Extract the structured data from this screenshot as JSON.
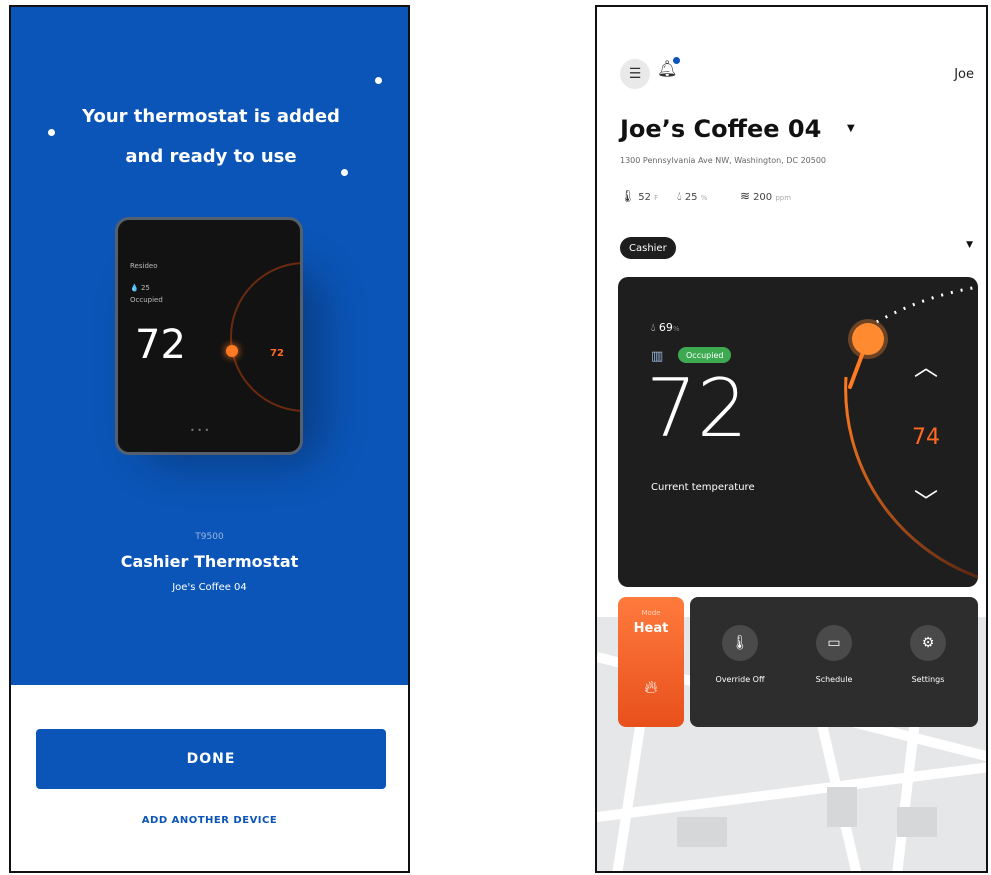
{
  "left_screen": {
    "headline_line1": "Your thermostat is added",
    "headline_line2": "and ready to use",
    "device_display": {
      "brand": "Resideo",
      "humidity": "25",
      "occupancy": "Occupied",
      "temperature": "72",
      "setpoint": "72"
    },
    "model": "T9500",
    "thermostat_name": "Cashier Thermostat",
    "location": "Joe's Coffee 04",
    "done_label": "DONE",
    "add_device_label": "ADD ANOTHER DEVICE",
    "colors": {
      "primary": "#0b55b8"
    }
  },
  "right_screen": {
    "user": "Joe",
    "store_name": "Joe’s Coffee 04",
    "address": "1300 Pennsylvania Ave NW, Washington, DC 20500",
    "metrics": [
      {
        "icon": "thermometer-icon",
        "value": "52",
        "unit": "F"
      },
      {
        "icon": "humidity-icon",
        "value": "25",
        "unit": "%"
      },
      {
        "icon": "air-quality-icon",
        "value": "200",
        "unit": "ppm"
      }
    ],
    "zone": "Cashier",
    "thermostat": {
      "humidity": "69",
      "humidity_unit": "%",
      "occupancy": "Occupied",
      "current_temp": "72",
      "current_temp_label": "Current temperature",
      "setpoint": "74"
    },
    "mode": {
      "label": "Mode",
      "value": "Heat"
    },
    "actions": [
      {
        "icon": "thermometer-override-icon",
        "label": "Override Off"
      },
      {
        "icon": "calendar-icon",
        "label": "Schedule"
      },
      {
        "icon": "gear-icon",
        "label": "Settings"
      }
    ],
    "colors": {
      "heat": "#ff6a20",
      "card": "#1e1e1e"
    }
  }
}
